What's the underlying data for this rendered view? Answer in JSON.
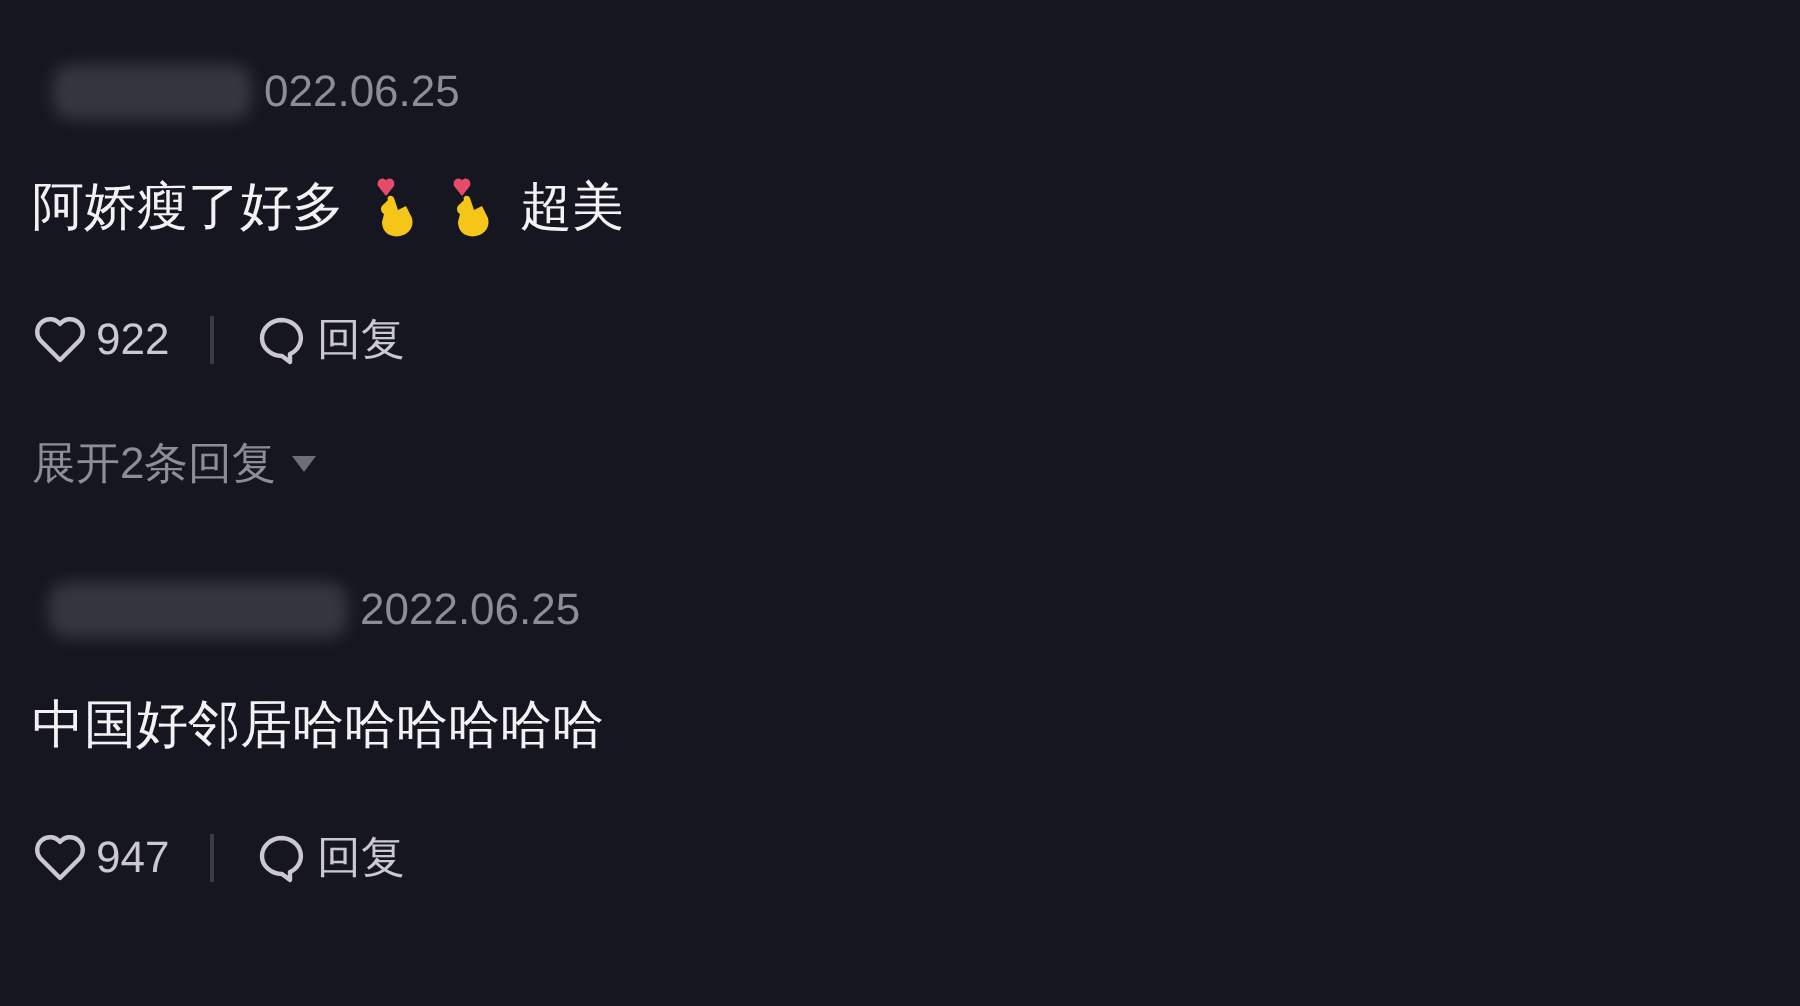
{
  "comments": [
    {
      "date": "022.06.25",
      "body": [
        {
          "kind": "text",
          "text": "阿娇瘦了好多"
        },
        {
          "kind": "emoji"
        },
        {
          "kind": "emoji"
        },
        {
          "kind": "text",
          "text": "超美"
        }
      ],
      "likes": "922",
      "reply": "回复",
      "expand": "展开2条回复"
    },
    {
      "date": "2022.06.25",
      "body": [
        {
          "kind": "text",
          "text": "中国好邻居哈哈哈哈哈哈"
        }
      ],
      "likes": "947",
      "reply": "回复"
    }
  ]
}
